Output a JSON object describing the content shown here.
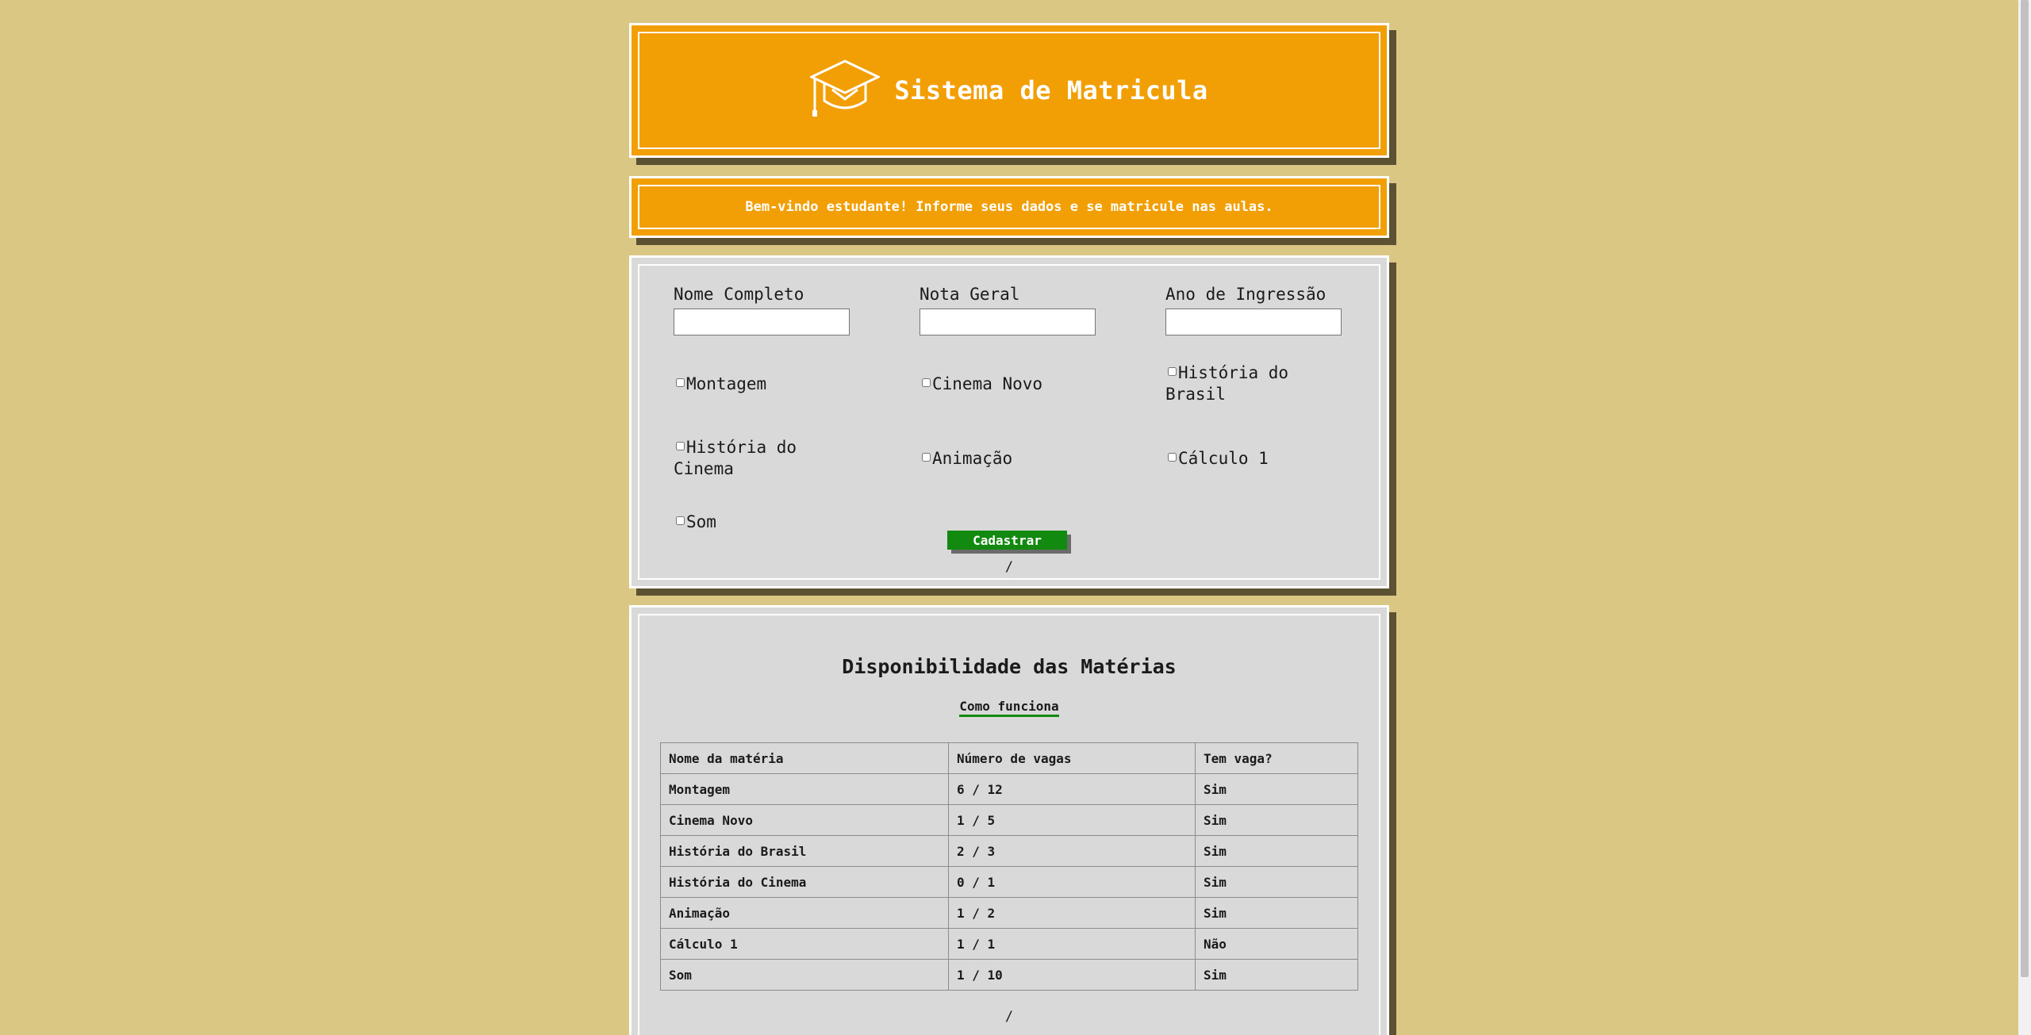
{
  "header": {
    "title": "Sistema de Matricula",
    "icon": "graduation-cap-icon"
  },
  "welcome": {
    "message": "Bem-vindo estudante! Informe seus dados e se matricule nas aulas."
  },
  "form": {
    "fields": [
      {
        "label": "Nome Completo",
        "value": ""
      },
      {
        "label": "Nota Geral",
        "value": ""
      },
      {
        "label": "Ano de Ingressão",
        "value": ""
      }
    ],
    "checkboxes": [
      {
        "label": "Montagem",
        "checked": false
      },
      {
        "label": "Cinema Novo",
        "checked": false
      },
      {
        "label": "História do Brasil",
        "checked": false
      },
      {
        "label": "História do Cinema",
        "checked": false
      },
      {
        "label": "Animação",
        "checked": false
      },
      {
        "label": "Cálculo 1",
        "checked": false
      },
      {
        "label": "Som",
        "checked": false
      }
    ],
    "submit_label": "Cadastrar",
    "footer_slash": "/"
  },
  "availability": {
    "title": "Disponibilidade das Matérias",
    "how_link": "Como funciona",
    "columns": [
      "Nome da matéria",
      "Número de vagas",
      "Tem vaga?"
    ],
    "rows": [
      [
        "Montagem",
        "6 / 12",
        "Sim"
      ],
      [
        "Cinema Novo",
        "1 / 5",
        "Sim"
      ],
      [
        "História do Brasil",
        "2 / 3",
        "Sim"
      ],
      [
        "História do Cinema",
        "0 / 1",
        "Sim"
      ],
      [
        "Animação",
        "1 / 2",
        "Sim"
      ],
      [
        "Cálculo 1",
        "1 / 1",
        "Não"
      ],
      [
        "Som",
        "1 / 10",
        "Sim"
      ]
    ],
    "footer_slash": "/"
  },
  "colors": {
    "background": "#dbc784",
    "orange": "#f29f05",
    "panel": "#d9d9d9",
    "button": "#128a0f",
    "shadow": "#5c5130"
  }
}
